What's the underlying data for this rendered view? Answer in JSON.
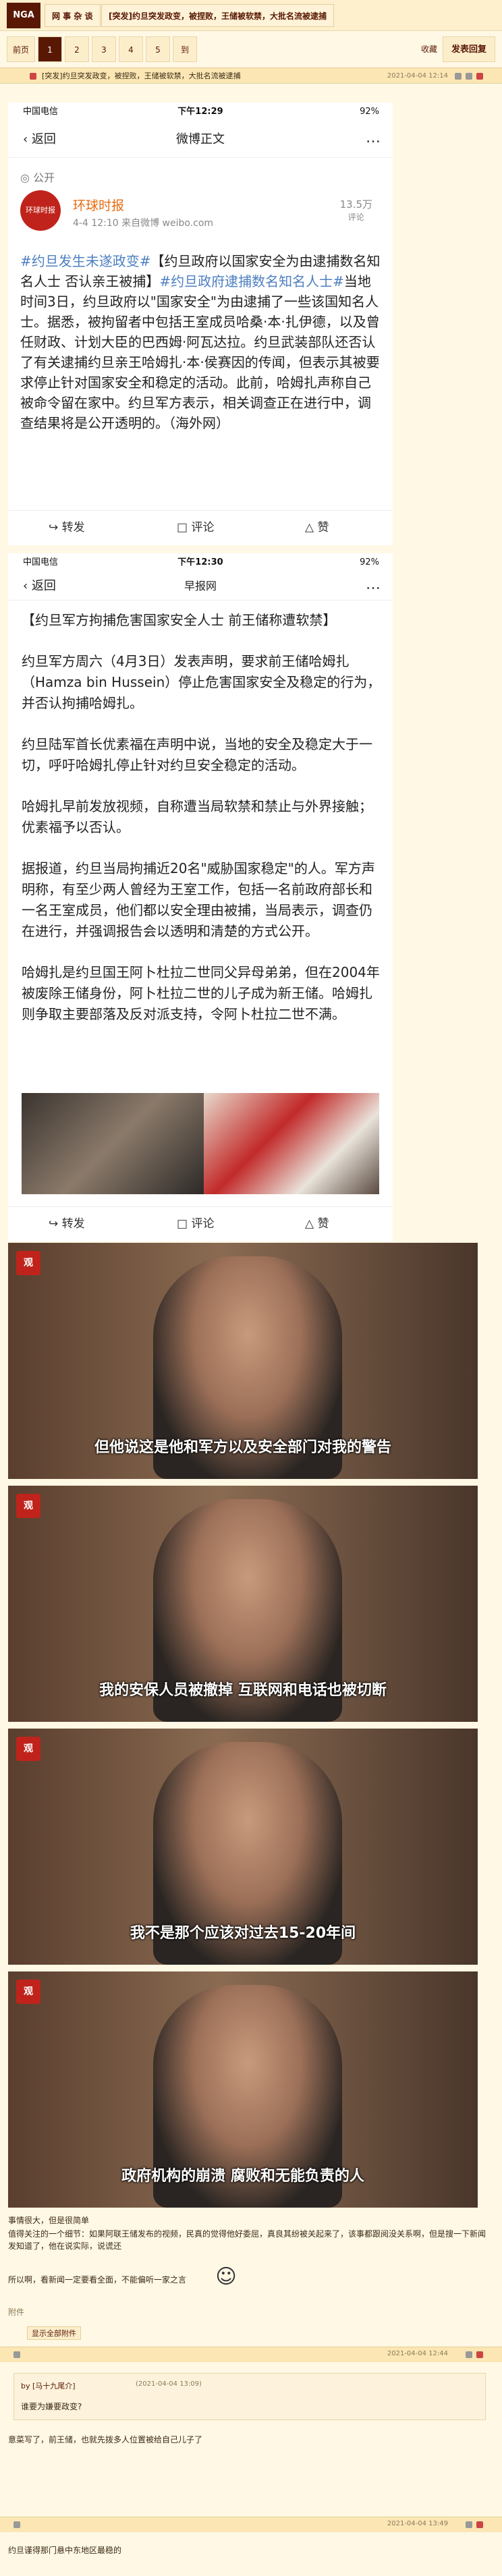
{
  "top": {
    "logo": "NGA",
    "crumbs": [
      "网 事 杂 谈",
      "[突发]约旦突发政变，被捏败，王储被软禁，大批名流被逮捕"
    ]
  },
  "pager": {
    "prev": "前页",
    "pages": [
      "1",
      "2",
      "3",
      "4",
      "5"
    ],
    "next": "到",
    "collect": "收藏",
    "reply": "发表回复"
  },
  "post": {
    "title": "[突发]约旦突发政变，被捏败，王储被软禁，大批名流被逮捕",
    "date": "2021-04-04 12:14"
  },
  "weibo1": {
    "carrier": "中国电信",
    "time": "下午12:29",
    "battery": "92%",
    "back": "返回",
    "title": "微博正文",
    "visibility": "公开",
    "author": "环球时报",
    "avatar_text": "环球时报",
    "meta": "4-4 12:10  来自微博 weibo.com",
    "fans": "13.5万",
    "fans_label": "评论",
    "text_tag1": "#约旦发生未遂政变#",
    "text_tag2": "【约旦政府以国家安全为由逮捕数名知名人士 否认亲王被捕】",
    "text_tag3": "#约旦政府逮捕数名知名人士#",
    "text": "当地时间3日，约旦政府以\"国家安全\"为由逮捕了一些该国知名人士。据悉，被拘留者中包括王室成员哈桑·本·扎伊德，以及曾任财政、计划大臣的巴西姆·阿瓦达拉。约旦武装部队还否认了有关逮捕约旦亲王哈姆扎·本·侯赛因的传闻，但表示其被要求停止针对国家安全和稳定的活动。此前，哈姆扎声称自己被命令留在家中。约旦军方表示，相关调查正在进行中，调查结果将是公开透明的。（海外网）",
    "share": "转发",
    "comment": "评论",
    "like": "赞"
  },
  "weibo2": {
    "carrier": "中国电信",
    "time": "下午12:30",
    "battery": "92%",
    "back": "返回",
    "source": "早报网",
    "p1": "【约旦军方拘捕危害国家安全人士 前王储称遭软禁】",
    "p2": "约旦军方周六（4月3日）发表声明，要求前王储哈姆扎（Hamza bin Hussein）停止危害国家安全及稳定的行为，并否认拘捕哈姆扎。",
    "p3": "约旦陆军首长优素福在声明中说，当地的安全及稳定大于一切，呼吁哈姆扎停止针对约旦安全稳定的活动。",
    "p4": "哈姆扎早前发放视频，自称遭当局软禁和禁止与外界接触；优素福予以否认。",
    "p5": "据报道，约旦当局拘捕近20名\"威胁国家稳定\"的人。军方声明称，有至少两人曾经为王室工作，包括一名前政府部长和一名王室成员，他们都以安全理由被捕，当局表示，调查仍在进行，并强调报告会以透明和清楚的方式公开。",
    "p6": "哈姆扎是约旦国王阿卜杜拉二世同父异母弟弟，但在2004年被废除王储身份，阿卜杜拉二世的儿子成为新王储。哈姆扎则争取主要部落及反对派支持，令阿卜杜拉二世不满。",
    "share": "转发",
    "comment": "评论",
    "like": "赞"
  },
  "videos": [
    {
      "badge": "观",
      "subtitle": "但他说这是他和军方以及安全部门对我的警告"
    },
    {
      "badge": "观",
      "subtitle": "我的安保人员被撤掉 互联网和电话也被切断"
    },
    {
      "badge": "观",
      "subtitle": "我不是那个应该对过去15-20年间"
    },
    {
      "badge": "观",
      "subtitle": "政府机构的崩溃 腐败和无能负责的人"
    }
  ],
  "footer": {
    "l1": "事情很大，但是很简单",
    "l2": "值得关注的一个细节：如果阿联王储发布的视频，民真的觉得他好委屈，真良其纷被关起来了，该事都跟阅没关系啊，但是搜一下新闻发知道了，他在说实际，说谎还",
    "l3": "所以啊，看新闻一定要看全面，不能偏听一家之言",
    "attach": "附件",
    "show_attach": "显示全部附件"
  },
  "reply1": {
    "date": "2021-04-04 12:44",
    "quote_user": "by [马十九尾介]",
    "quote_date": "(2021-04-04 13:09)",
    "quote_text": "谁要为嫌要政变?",
    "text": "意菜写了，前王储，也就先拨多人位置被给自己儿子了"
  },
  "reply2": {
    "date": "2021-04-04 13:49",
    "text": "约旦谨得那门悬中东地区最稳的"
  }
}
